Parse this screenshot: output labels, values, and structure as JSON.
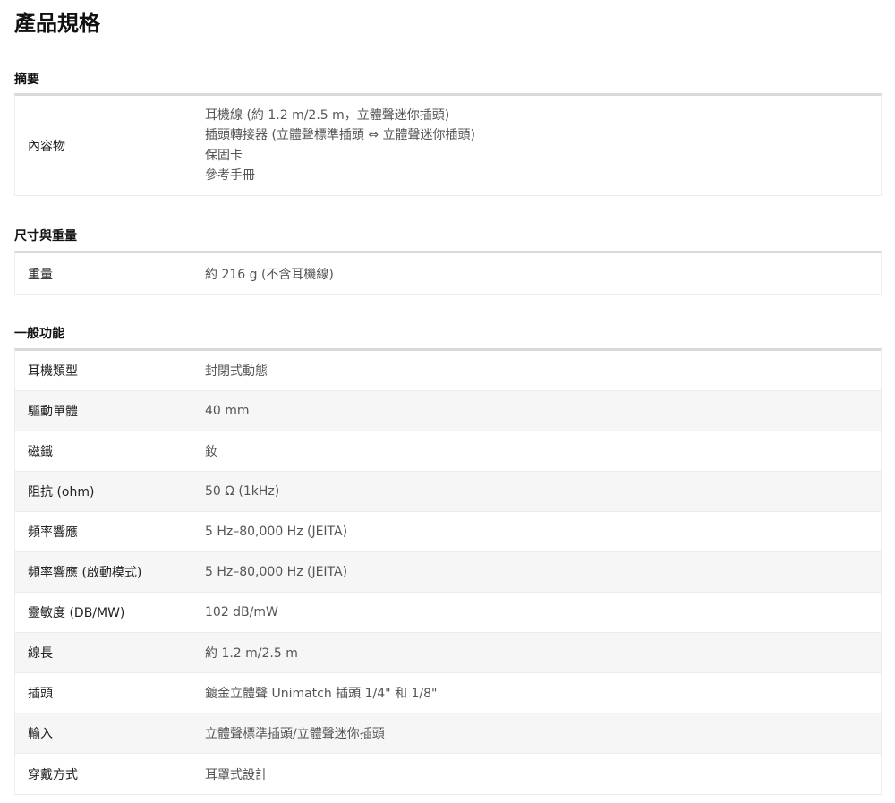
{
  "page_title": "產品規格",
  "sections": [
    {
      "heading": "摘要",
      "rows": [
        {
          "label": "內容物",
          "values": [
            "耳機線 (約 1.2 m/2.5 m，立體聲迷你插頭)",
            "插頭轉接器 (立體聲標準插頭 ⇔ 立體聲迷你插頭)",
            "保固卡",
            "參考手冊"
          ]
        }
      ]
    },
    {
      "heading": "尺寸與重量",
      "rows": [
        {
          "label": "重量",
          "value": "約 216 g (不含耳機線)"
        }
      ]
    },
    {
      "heading": "一般功能",
      "rows": [
        {
          "label": "耳機類型",
          "value": "封閉式動態"
        },
        {
          "label": "驅動單體",
          "value": "40 mm"
        },
        {
          "label": "磁鐵",
          "value": "釹"
        },
        {
          "label": "阻抗 (ohm)",
          "value": "50 Ω (1kHz)"
        },
        {
          "label": "頻率響應",
          "value": "5 Hz–80,000 Hz (JEITA)"
        },
        {
          "label": "頻率響應 (啟動模式)",
          "value": "5 Hz–80,000 Hz (JEITA)"
        },
        {
          "label": "靈敏度 (DB/MW)",
          "value": "102 dB/mW"
        },
        {
          "label": "線長",
          "value": "約 1.2 m/2.5 m"
        },
        {
          "label": "插頭",
          "value": "鍍金立體聲 Unimatch 插頭 1/4\" 和 1/8\""
        },
        {
          "label": "輸入",
          "value": "立體聲標準插頭/立體聲迷你插頭"
        },
        {
          "label": "穿戴方式",
          "value": "耳罩式設計"
        }
      ]
    }
  ]
}
